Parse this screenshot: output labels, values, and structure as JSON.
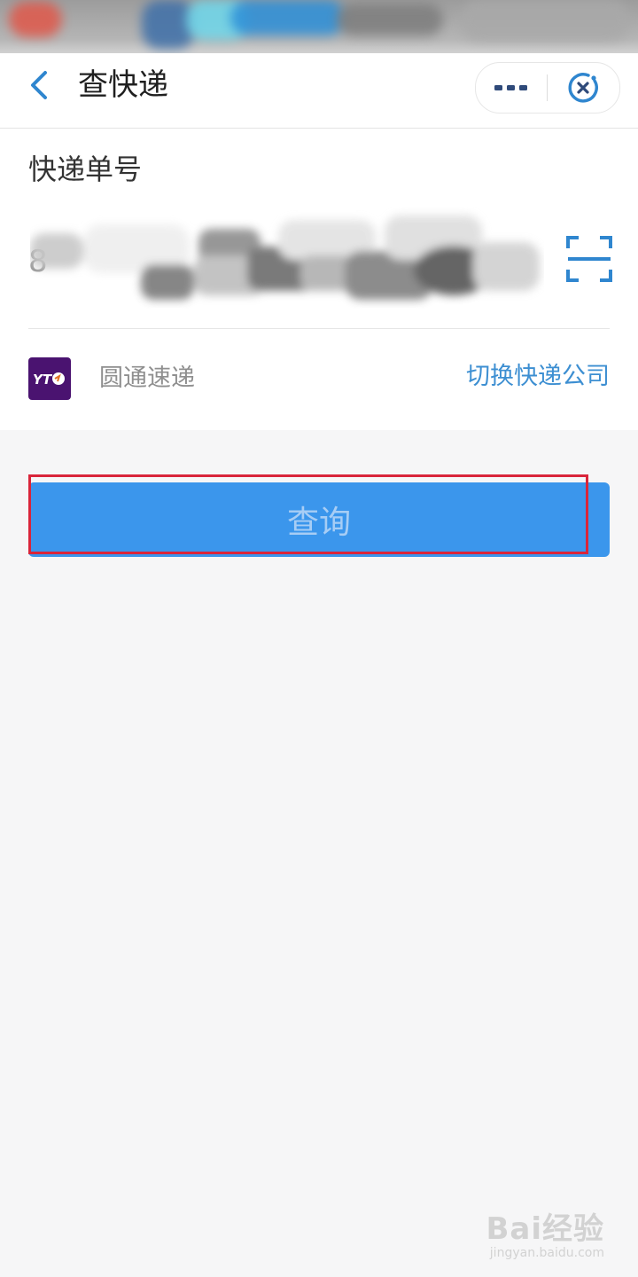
{
  "header": {
    "title": "查快递",
    "back_icon": "chevron-left-icon",
    "more_icon": "more-dots-icon",
    "close_icon": "close-circle-icon"
  },
  "form": {
    "tracking_label": "快递单号",
    "tracking_value": "8",
    "scan_icon": "scan-frame-icon"
  },
  "company": {
    "logo_text": "YT",
    "name": "圆通速递",
    "switch_label": "切换快递公司"
  },
  "actions": {
    "query_label": "查询"
  },
  "watermark": {
    "main": "Bai经验",
    "sub": "jingyan.baidu.com"
  },
  "colors": {
    "accent": "#3d8fd2",
    "button": "#3b96ec",
    "highlight": "#d9253a",
    "logo_bg": "#4a1370"
  }
}
